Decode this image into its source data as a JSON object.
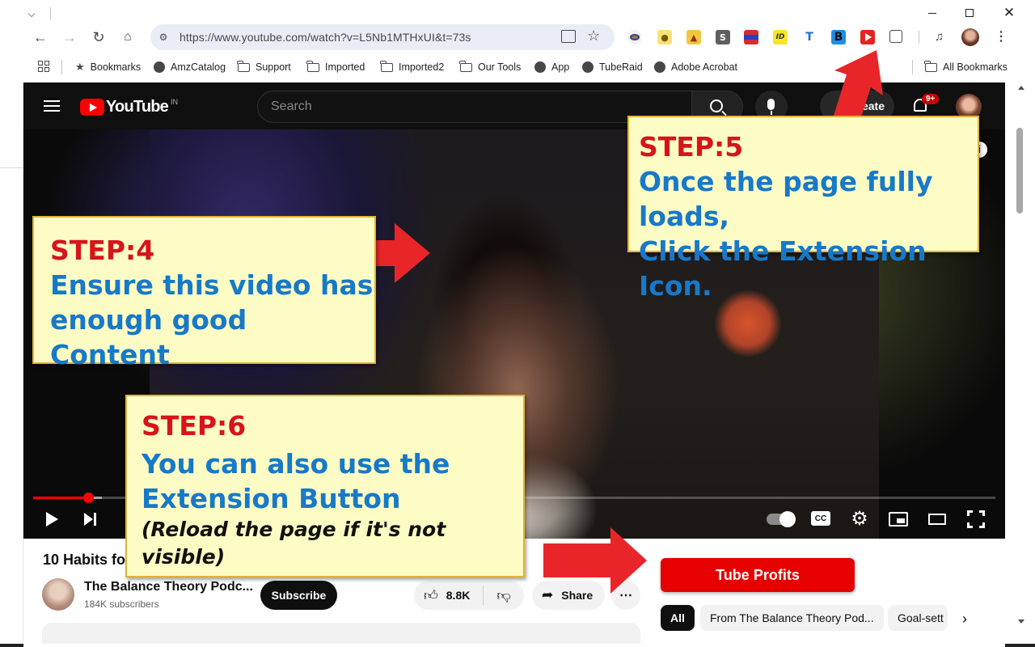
{
  "browser": {
    "url": "https://www.youtube.com/watch?v=L5Nb1MTHxUI&t=73s",
    "bookmarks": [
      "Bookmarks",
      "AmzCatalog",
      "Support",
      "Imported",
      "Imported2",
      "Our Tools",
      "App",
      "TubeRaid",
      "Adobe Acrobat"
    ],
    "all_bookmarks": "All Bookmarks",
    "ext_labels": {
      "s": "S",
      "id": "ID",
      "t": "T",
      "b": "B"
    }
  },
  "youtube": {
    "logo_text": "YouTube",
    "region": "IN",
    "search_placeholder": "Search",
    "create_label": "Create",
    "notif_count": "9+"
  },
  "video": {
    "title_visible": "10 Habits fo",
    "channel_name": "The Balance Theory Podc...",
    "subscribers": "184K subscribers",
    "subscribe_label": "Subscribe",
    "likes": "8.8K",
    "share_label": "Share",
    "progress_fraction": 0.057,
    "cc_label": "CC"
  },
  "sidebar": {
    "tube_profits_label": "Tube Profits",
    "chips": [
      "All",
      "From The Balance Theory Pod...",
      "Goal-sett"
    ]
  },
  "callouts": {
    "step4": {
      "step": "STEP:4",
      "line1": "Ensure this video has",
      "line2": "enough good Content"
    },
    "step5": {
      "step": "STEP:5",
      "line1": "Once the page fully loads,",
      "line2": "Click the Extension Icon."
    },
    "step6": {
      "step": "STEP:6",
      "line1": "You can also use the",
      "line2": "Extension Button",
      "note": "(Reload the page if it's not visible)"
    }
  },
  "colors": {
    "arrow": "#e8262a",
    "callout_bg": "#fdfcc4",
    "step_red": "#d6151b",
    "step_blue": "#1779c9",
    "yt_red": "#e60000"
  }
}
